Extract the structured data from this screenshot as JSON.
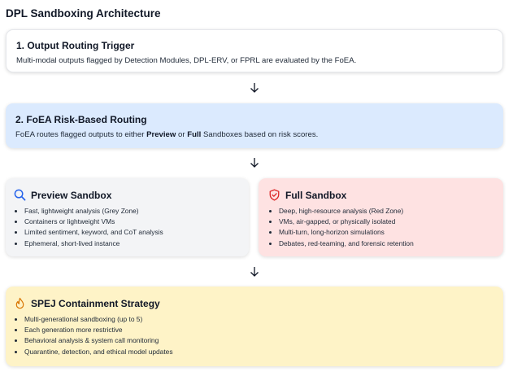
{
  "title": "DPL Sandboxing Architecture",
  "step1": {
    "heading": "1. Output Routing Trigger",
    "text": "Multi-modal outputs flagged by Detection Modules, DPL-ERV, or FPRL are evaluated by the FoEA."
  },
  "step2": {
    "heading": "2. FoEA Risk-Based Routing",
    "text_a": "FoEA routes flagged outputs to either ",
    "bold_preview": "Preview",
    "text_b": " or ",
    "bold_full": "Full",
    "text_c": " Sandboxes based on risk scores."
  },
  "preview": {
    "heading": "Preview Sandbox",
    "icon": "magnifier-icon",
    "items": [
      "Fast, lightweight analysis (Grey Zone)",
      "Containers or lightweight VMs",
      "Limited sentiment, keyword, and CoT analysis",
      "Ephemeral, short-lived instance"
    ]
  },
  "full": {
    "heading": "Full Sandbox",
    "icon": "shield-icon",
    "items": [
      "Deep, high-resource analysis (Red Zone)",
      "VMs, air-gapped, or physically isolated",
      "Multi-turn, long-horizon simulations",
      "Debates, red-teaming, and forensic retention"
    ]
  },
  "spej": {
    "heading": "SPEJ Containment Strategy",
    "icon": "flame-icon",
    "items": [
      "Multi-generational sandboxing (up to 5)",
      "Each generation more restrictive",
      "Behavioral analysis & system call monitoring",
      "Quarantine, detection, and ethical model updates"
    ]
  },
  "colors": {
    "step1_bg": "#ffffff",
    "step2_bg": "#dbeafe",
    "preview_bg": "#f3f4f6",
    "full_bg": "#fee2e2",
    "spej_bg": "#fef3c7",
    "preview_icon": "#2563eb",
    "full_icon": "#dc2626",
    "spej_icon": "#d97706"
  }
}
